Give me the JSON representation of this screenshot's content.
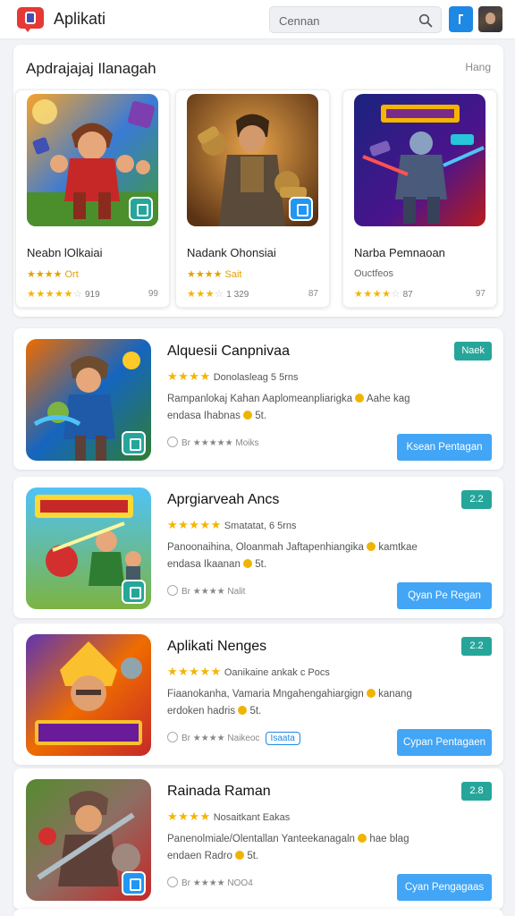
{
  "header": {
    "app_title": "Aplikati",
    "search_placeholder": "Cennan"
  },
  "featured": {
    "title": "Apdrajajaj Ilanagah",
    "see_all": "Hang",
    "cards": [
      {
        "name": "Neabn lOlkaiai",
        "sub": "★★★★ Ort",
        "sub_kind": "accent",
        "stars": 4,
        "rating_text": "919",
        "count": "99"
      },
      {
        "name": "Nadank Ohonsiai",
        "sub": "★★★★ Sait",
        "sub_kind": "accent",
        "stars": 3,
        "rating_text": "1 329",
        "count": "87"
      },
      {
        "name": "Narba Pemnaoan",
        "sub": "Ouctfeos",
        "sub_kind": "grey",
        "stars": 4,
        "rating_text": "87",
        "count": "97"
      }
    ]
  },
  "list": [
    {
      "name": "Alquesii Canpnivaa",
      "meta": "Donolasleag 5 5rns",
      "stars": "★★★★",
      "desc_1": "Rampanlokaj Kahan Aaplomeanpliarigka",
      "desc_1b": "Aahe kag",
      "desc_2": "endasa Ihabnas",
      "desc_2b": "5t.",
      "stat": "Br ★★★★★ Moiks",
      "tag": "Naek",
      "button": "Ksean Pentagan"
    },
    {
      "name": "Aprgiarveah Ancs",
      "meta": "Smatatat, 6 5rns",
      "stars": "★★★★★",
      "desc_1": "Panoonaihina, Oloanmah Jaftapenhiangika",
      "desc_1b": "kamtkae",
      "desc_2": "endasa Ikaanan",
      "desc_2b": "5t.",
      "stat": "Br ★★★★ Nalit",
      "tag": "2.2",
      "button": "Qyan Pe Regan"
    },
    {
      "name": "Aplikati Nenges",
      "meta": "Oanikaine ankak c Pocs",
      "stars": "★★★★★",
      "desc_1": "Fiaanokanha, Vamaria Mngahengahiargign",
      "desc_1b": "kanang",
      "desc_2": "erdoken hadris",
      "desc_2b": "5t.",
      "stat": "Br ★★★★ Naikeoc",
      "badge": "Isaata",
      "tag": "2.2",
      "button": "Cypan Pentagaen"
    },
    {
      "name": "Rainada Raman",
      "meta": "Nosaitkant Eakas",
      "stars": "★★★★",
      "desc_1": "Panenolmiale/Olentallan Yanteekanagaln",
      "desc_1b": "hae blag",
      "desc_2": "endaen Radro",
      "desc_2b": "5t.",
      "stat": "Br ★★★★ NOO4",
      "tag": "2.8",
      "button": "Cyan Pengagaas"
    }
  ],
  "colors": {
    "accent": "#42a5f5",
    "tag": "#26a69a",
    "star": "#f5b400",
    "logo": "#e53935"
  }
}
